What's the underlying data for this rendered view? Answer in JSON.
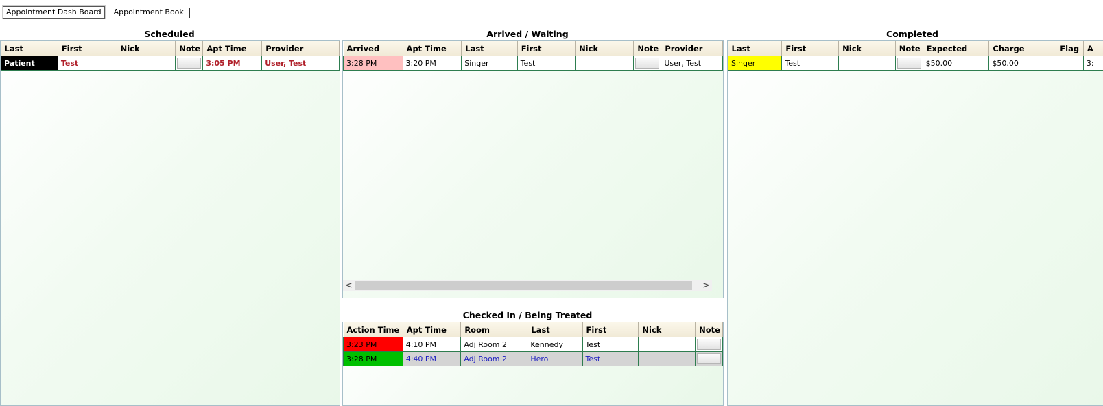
{
  "tabs": [
    {
      "label": "Appointment Dash Board",
      "active": true
    },
    {
      "label": "Appointment Book",
      "active": false
    }
  ],
  "scheduled": {
    "title": "Scheduled",
    "columns": [
      "Last",
      "First",
      "Nick",
      "Note",
      "Apt Time",
      "Provider"
    ],
    "rows": [
      {
        "last": "Patient",
        "first": "Test",
        "nick": "",
        "note": "",
        "apt_time": "3:05 PM",
        "provider": "User, Test"
      }
    ]
  },
  "arrived": {
    "title": "Arrived / Waiting",
    "columns": [
      "Arrived",
      "Apt Time",
      "Last",
      "First",
      "Nick",
      "Note",
      "Provider"
    ],
    "rows": [
      {
        "arrived": "3:28 PM",
        "apt_time": "3:20 PM",
        "last": "Singer",
        "first": "Test",
        "nick": "",
        "note": "",
        "provider": "User, Test"
      }
    ],
    "scroll_left": "<",
    "scroll_right": ">"
  },
  "checked_in": {
    "title": "Checked In / Being Treated",
    "columns": [
      "Action Time",
      "Apt Time",
      "Room",
      "Last",
      "First",
      "Nick",
      "Note"
    ],
    "rows": [
      {
        "action_time": "3:23 PM",
        "apt_time": "4:10 PM",
        "room": "Adj Room 2",
        "last": "Kennedy",
        "first": "Test",
        "nick": "",
        "note": "",
        "status_color": "#ff0000"
      },
      {
        "action_time": "3:28 PM",
        "apt_time": "4:40 PM",
        "room": "Adj Room 2",
        "last": "Hero",
        "first": "Test",
        "nick": "",
        "note": "",
        "status_color": "#00c000"
      }
    ]
  },
  "completed": {
    "title": "Completed",
    "columns": [
      "Last",
      "First",
      "Nick",
      "Note",
      "Expected",
      "Charge",
      "Flag",
      "A"
    ],
    "rows": [
      {
        "last": "Singer",
        "first": "Test",
        "nick": "",
        "note": "",
        "expected": "$50.00",
        "charge": "$50.00",
        "flag": "",
        "extra": "3:"
      }
    ]
  },
  "colors": {
    "arrived_highlight": "#ffc0c0",
    "completed_highlight": "#ffff00",
    "scheduled_highlight": "#000000"
  }
}
